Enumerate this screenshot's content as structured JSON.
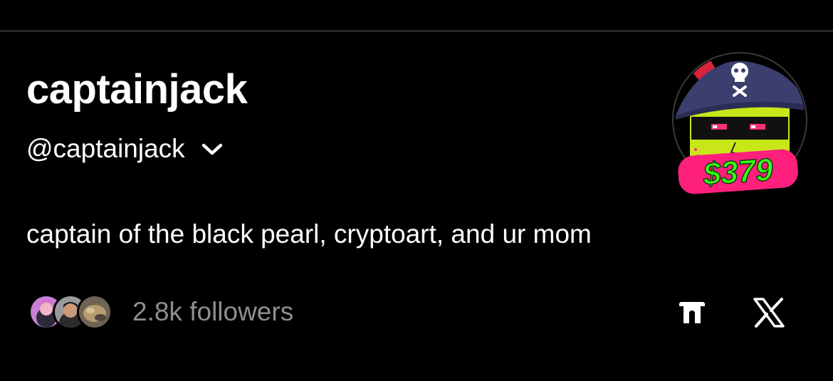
{
  "profile": {
    "display_name": "captainjack",
    "handle": "@captainjack",
    "bio": "captain of the black pearl, cryptoart, and ur mom",
    "followers_label": "2.8k followers",
    "avatar_badge": "$379"
  },
  "icons": {
    "chevron": "chevron-down-icon",
    "links": [
      "threads-gate-icon",
      "x-logo-icon"
    ]
  },
  "colors": {
    "background": "#000000",
    "text": "#ffffff",
    "muted": "#8e8e8e",
    "badge_fill": "#ff1f7d",
    "badge_text": "#39ff14"
  }
}
